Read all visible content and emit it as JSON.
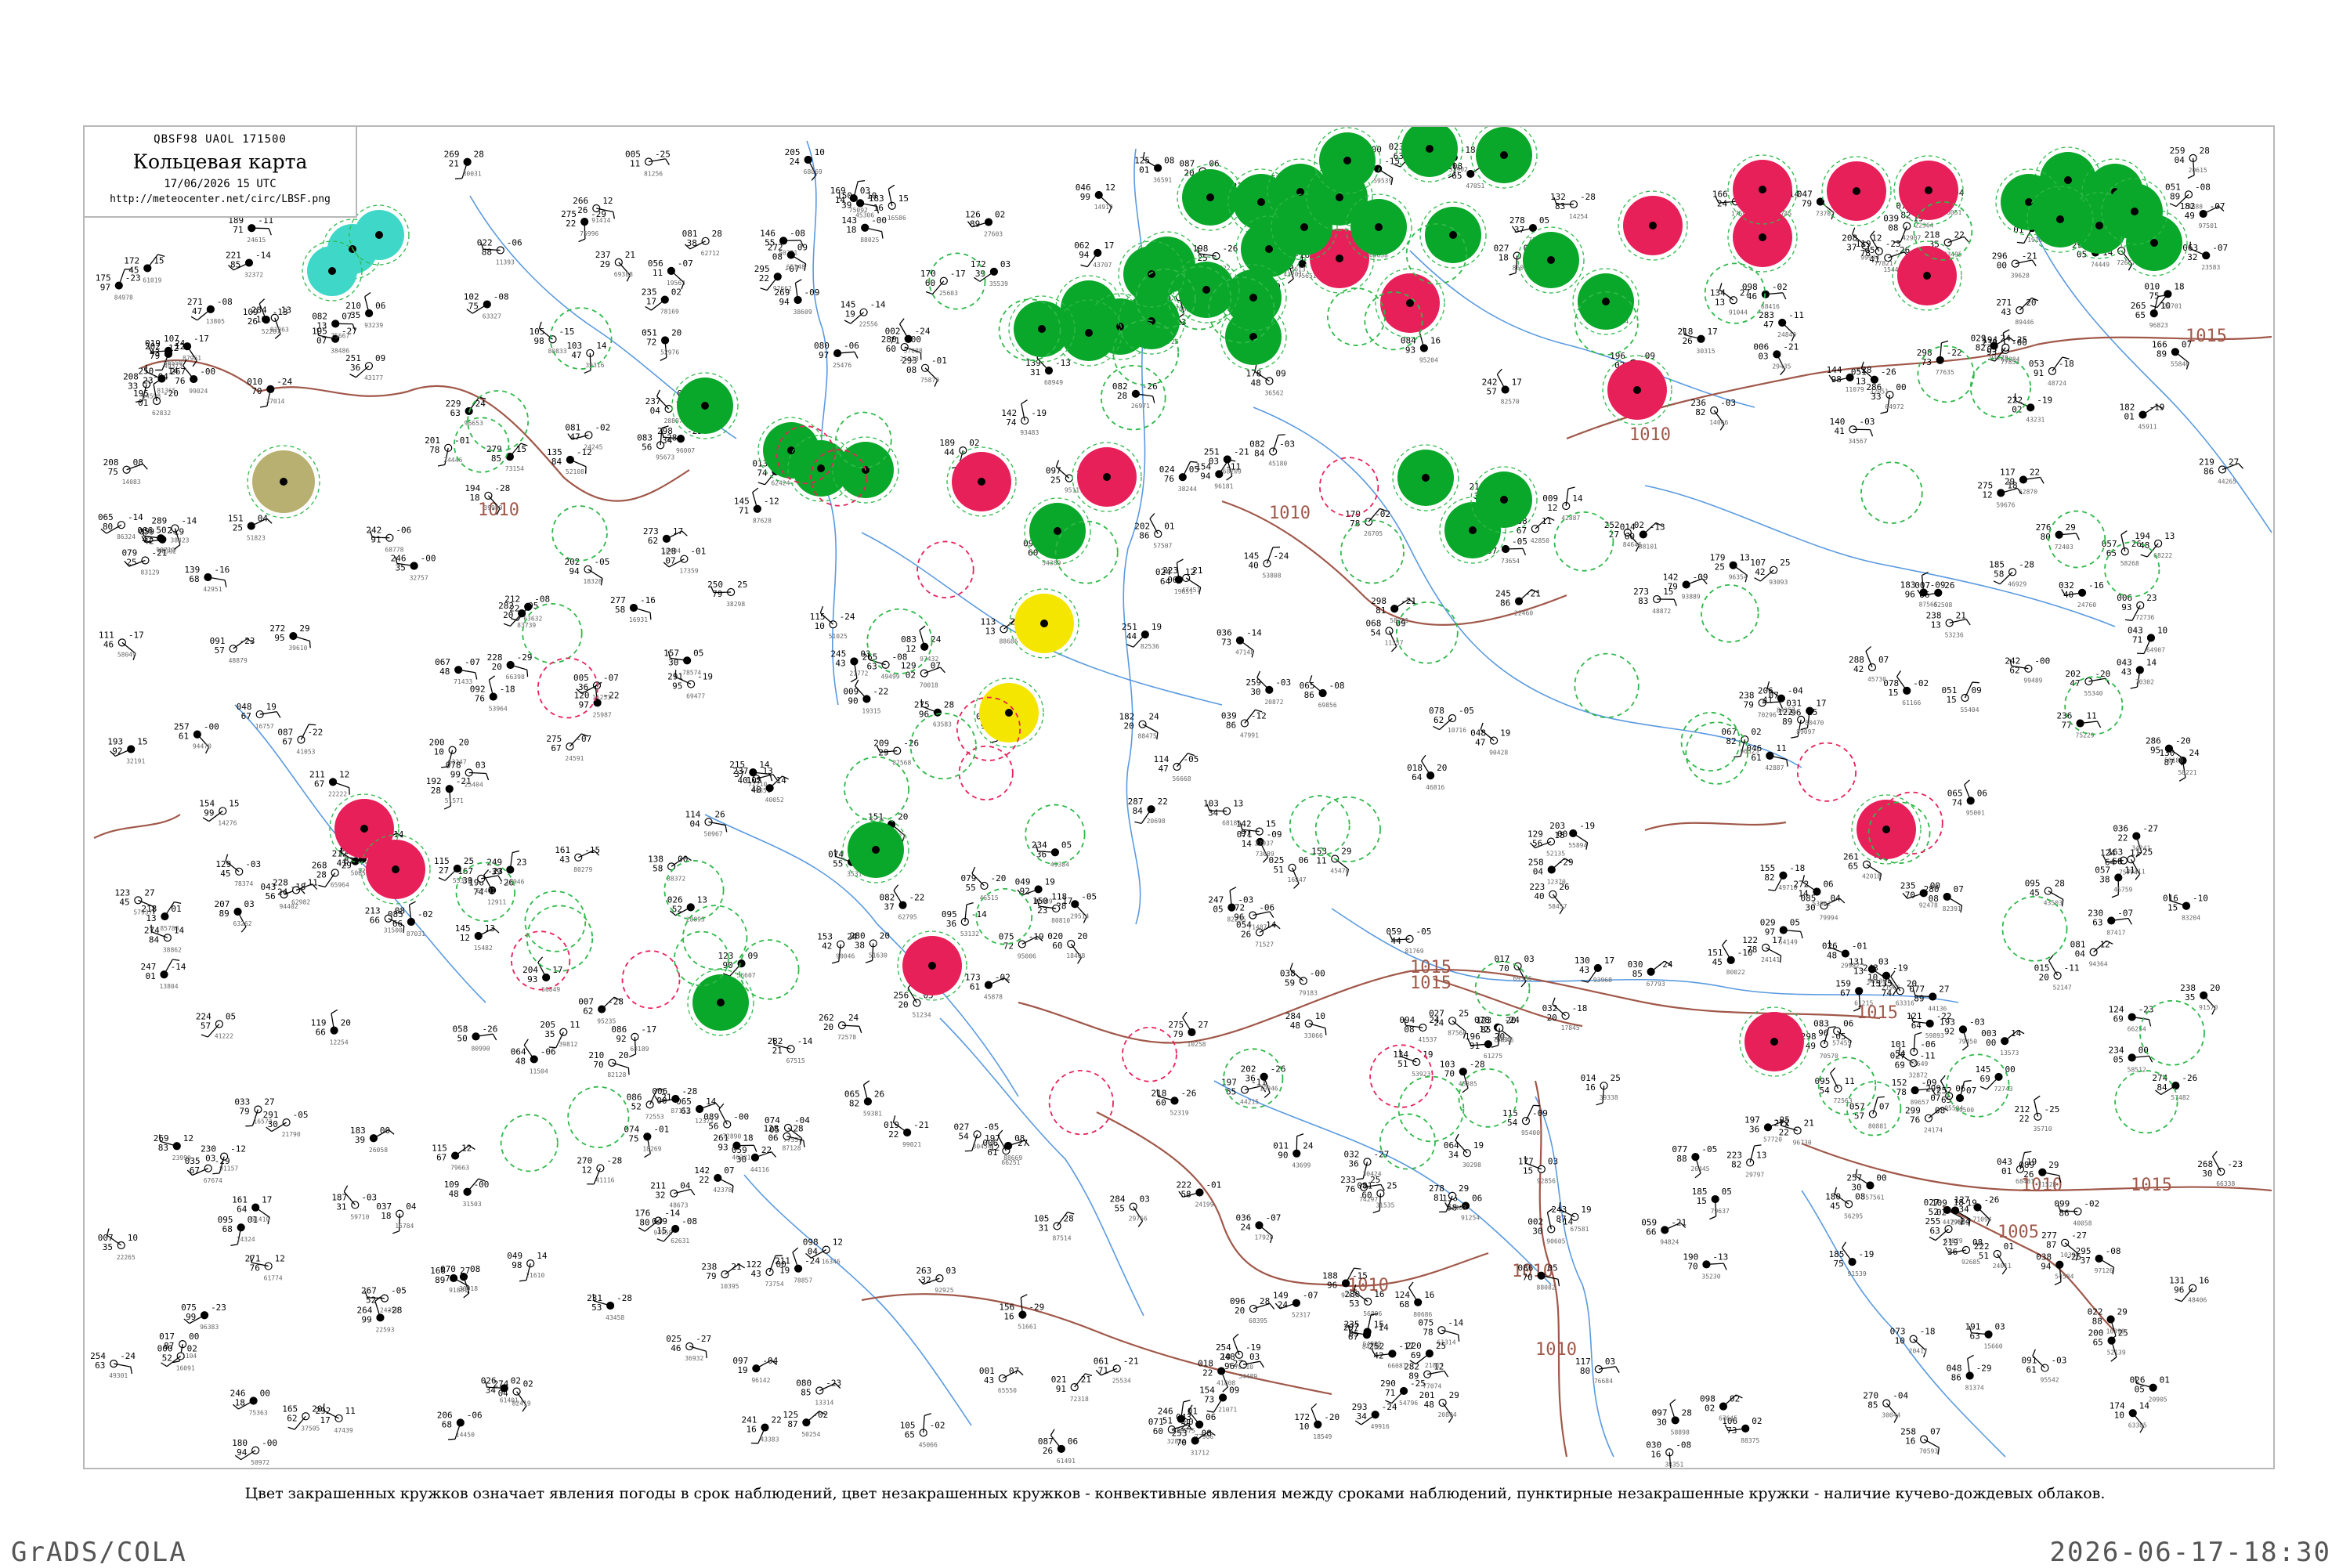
{
  "header": {
    "code_line": "QBSF98  UAOL  171500",
    "title": "Кольцевая карта",
    "datetime": "17/06/2026 15 UTC",
    "url": "http://meteocenter.net/circ/LBSF.png"
  },
  "legend_text": "Цвет закрашенных кружков означает явления погоды в срок наблюдений, цвет незакрашенных кружков - конвективные явления между сроками наблюдений, пунктирные незакрашенные кружки - наличие кучево-дождевых облаков.",
  "footer": {
    "software": "GrADS/COLA",
    "timestamp": "2026-06-17-18:30"
  },
  "colors": {
    "thunderstorm": "#e8205a",
    "rain": "#0aa82a",
    "shower_outline": "#2fb84a",
    "snow": "#3fd8c8",
    "fog": "#f5e600",
    "dust": "#b8b070",
    "isobar": "#a0584a",
    "river": "#5a9ae0",
    "border": "#b8b8b8"
  },
  "isobar_labels": [
    "1015",
    "1015",
    "1010",
    "1010",
    "1010",
    "1015",
    "1015",
    "1010",
    "1015",
    "1010",
    "1010",
    "1005",
    "1010",
    "1015"
  ],
  "stations": {
    "filled_thunderstorm_count": 16,
    "filled_rain_count": 40,
    "filled_snow_count": 3,
    "filled_fog_count": 2,
    "filled_dust_count": 1,
    "dashed_cb_count": 75
  }
}
